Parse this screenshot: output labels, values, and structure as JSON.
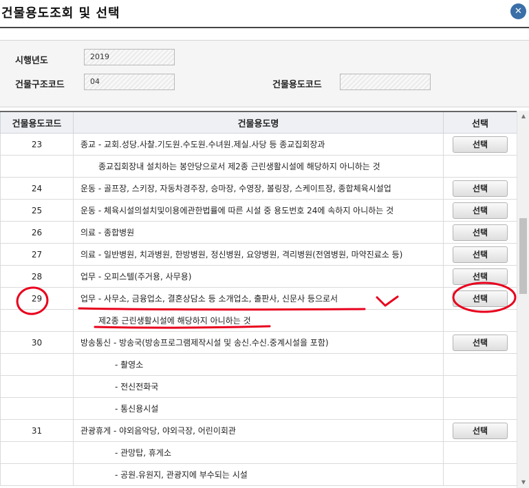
{
  "dialog": {
    "title": "건물용도조회 및 선택",
    "close_icon": "close-icon"
  },
  "search": {
    "year_label": "시행년도",
    "year_value": "2019",
    "structure_label": "건물구조코드",
    "structure_value": "04",
    "usage_label": "건물용도코드",
    "usage_value": ""
  },
  "table": {
    "headers": [
      "건물용도코드",
      "건물용도명",
      "선택"
    ],
    "select_label": "선택",
    "rows": [
      {
        "code": "23",
        "name": "종교 - 교회.성당.사찰.기도원.수도원.수녀원.제실.사당 등 종교집회장과"
      },
      {
        "code": "",
        "name": "종교집회장내 설치하는 봉안당으로서 제2종 근린생활시설에 해당하지 아니하는 것"
      },
      {
        "code": "24",
        "name": "운동 - 골프장, 스키장, 자동차경주장, 승마장, 수영장, 볼링장, 스케이트장, 종합체육시설업"
      },
      {
        "code": "25",
        "name": "운동 - 체육시설의설치및이용에관한법률에 따른 시설 중 용도번호 24에 속하지 아니하는 것"
      },
      {
        "code": "26",
        "name": "의료 - 종합병원"
      },
      {
        "code": "27",
        "name": "의료 - 일반병원, 치과병원, 한방병원, 정신병원, 요양병원, 격리병원(전염병원, 마약진료소 등)"
      },
      {
        "code": "28",
        "name": "업무 - 오피스텔(주거용, 사무용)"
      },
      {
        "code": "29",
        "name": "업무 - 사무소, 금융업소, 결혼상담소 등 소개업소, 출판사, 신문사 등으로서"
      },
      {
        "code": "",
        "name": "제2종 근린생활시설에 해당하지 아니하는 것"
      },
      {
        "code": "30",
        "name": "방송통신 - 방송국(방송프로그램제작시설 및 송신.수신.중계시설을 포함)"
      },
      {
        "code": "",
        "name": "- 촬영소"
      },
      {
        "code": "",
        "name": "- 전신전화국"
      },
      {
        "code": "",
        "name": "- 통신용시설"
      },
      {
        "code": "31",
        "name": "관광휴게 - 야외음악당, 야외극장, 어린이회관"
      },
      {
        "code": "",
        "name": "- 관망탑, 휴게소"
      },
      {
        "code": "",
        "name": "- 공원.유원지, 관광지에 부수되는 시설"
      }
    ]
  },
  "annotation": {
    "color": "#e8001c"
  }
}
